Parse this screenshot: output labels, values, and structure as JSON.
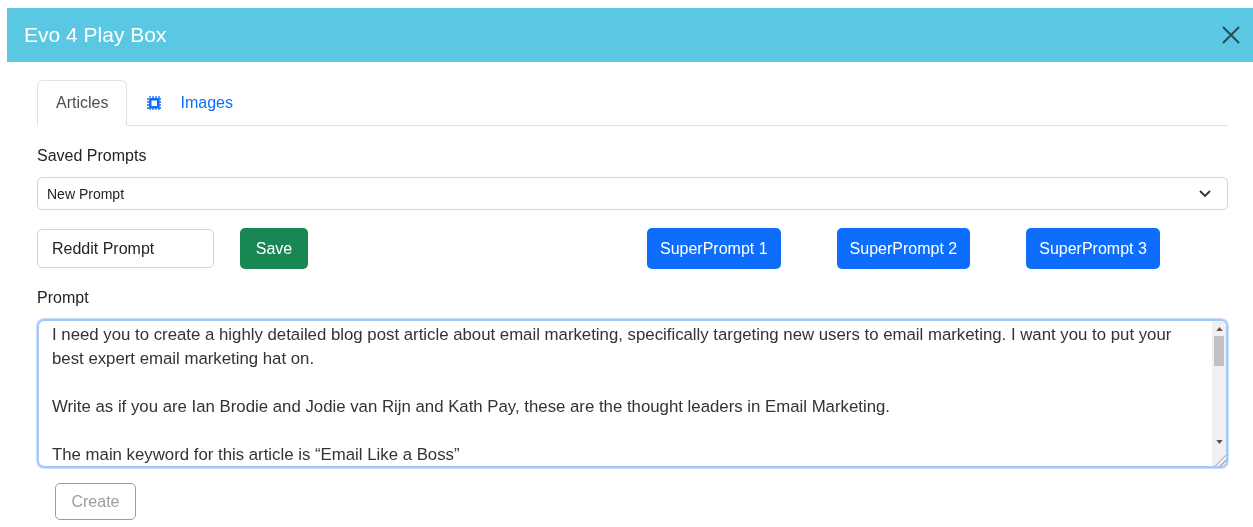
{
  "window": {
    "title": "Evo 4 Play Box"
  },
  "tabs": [
    {
      "label": "Articles",
      "selected": true,
      "icon": false
    },
    {
      "label": "Images",
      "selected": false,
      "icon": true
    }
  ],
  "saved_prompts": {
    "label": "Saved Prompts",
    "value": "New Prompt"
  },
  "prompt_name": {
    "value": "Reddit Prompt"
  },
  "save_button": "Save",
  "super_prompts": [
    "SuperPrompt 1",
    "SuperPrompt 2",
    "SuperPrompt 3"
  ],
  "prompt": {
    "label": "Prompt",
    "focused": true,
    "paragraphs": [
      "I need you to create a highly detailed blog post article about email marketing, specifically targeting new users to email marketing. I want you to put your best expert email marketing hat on.",
      "Write as if you are Ian Brodie and Jodie van Rijn and Kath Pay, these are the thought leaders in Email Marketing.",
      "The main keyword for this article is “Email Like a Boss”"
    ]
  },
  "create_button": {
    "label": "Create",
    "disabled": true
  }
}
